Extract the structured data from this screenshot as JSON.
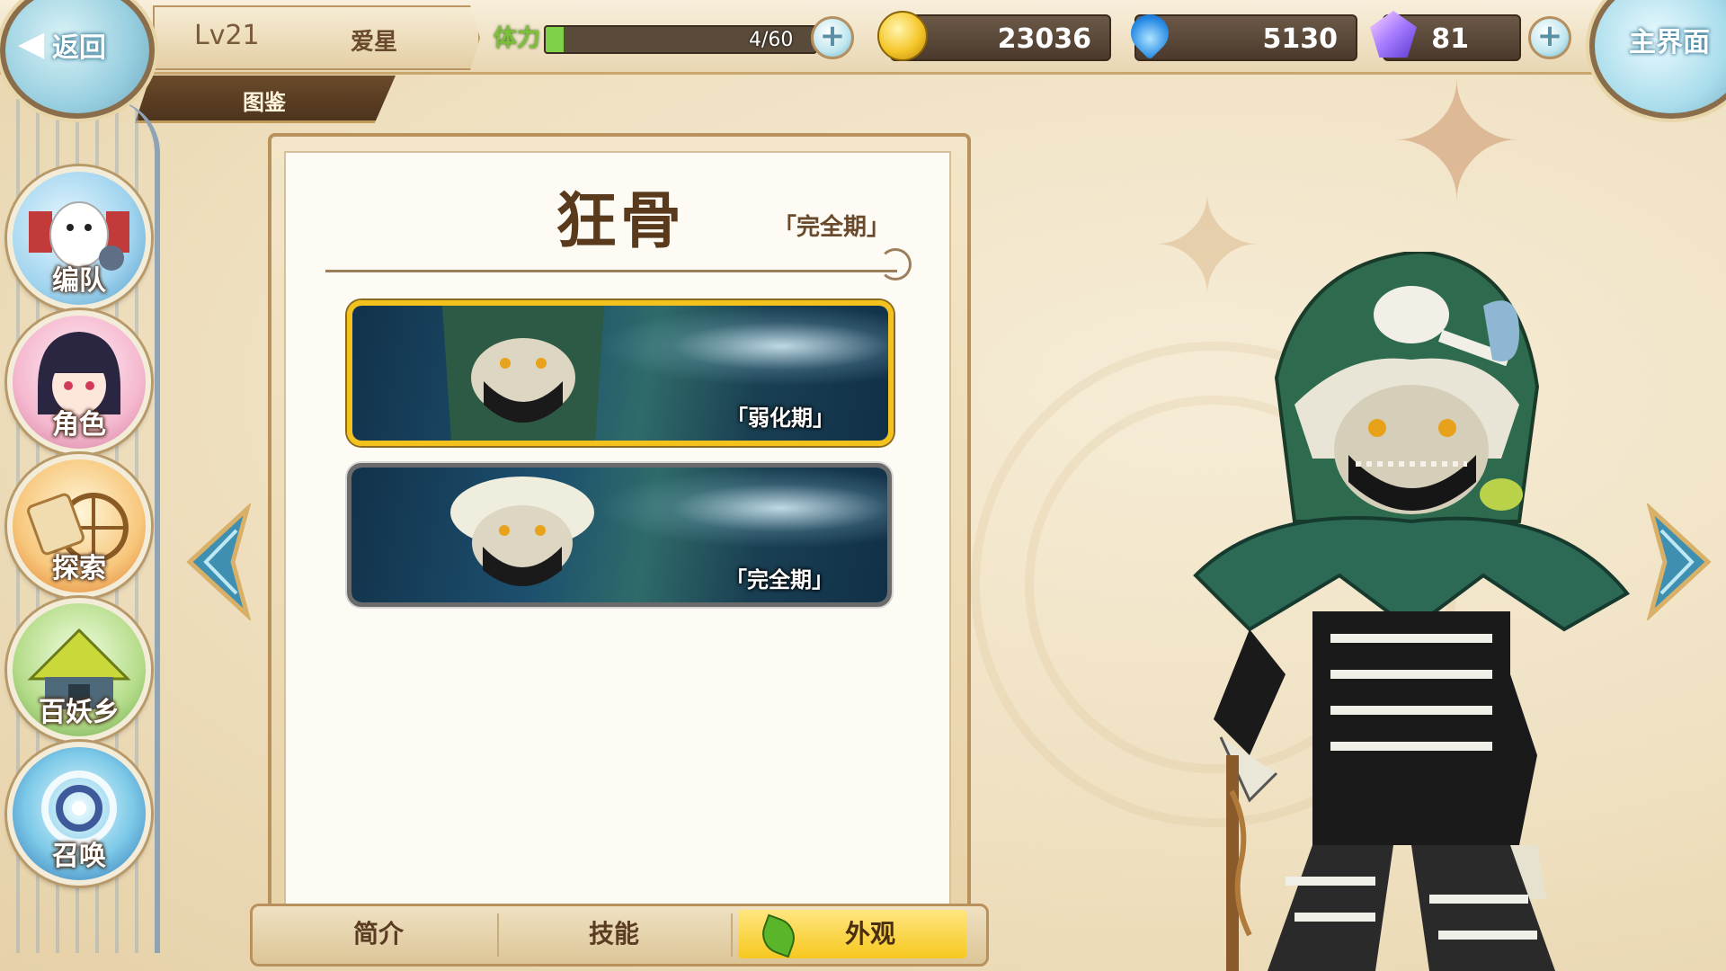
{
  "header": {
    "back_label": "返回",
    "home_label": "主界面",
    "level": "Lv21",
    "player_name": "爱星",
    "section_tab": "图鉴"
  },
  "stamina": {
    "label": "体力",
    "value": "4/60",
    "fraction": 0.067
  },
  "resources": {
    "gold": "23036",
    "soul": "5130",
    "gems": "81"
  },
  "sidebar": {
    "items": [
      {
        "label": "编队",
        "icon": "team-icon"
      },
      {
        "label": "角色",
        "icon": "character-icon"
      },
      {
        "label": "探索",
        "icon": "explore-icon"
      },
      {
        "label": "百妖乡",
        "icon": "village-icon"
      },
      {
        "label": "召唤",
        "icon": "summon-icon"
      }
    ]
  },
  "character": {
    "name": "狂骨",
    "stage": "「完全期」"
  },
  "skins": [
    {
      "label": "「弱化期」",
      "selected": true
    },
    {
      "label": "「完全期」",
      "selected": false
    }
  ],
  "tabs": [
    {
      "label": "简介",
      "active": false
    },
    {
      "label": "技能",
      "active": false
    },
    {
      "label": "外观",
      "active": true
    }
  ],
  "colors": {
    "selected_border": "#f4c21c",
    "active_tab": "#f6c81e",
    "panel_bg": "#fdfbf4"
  }
}
